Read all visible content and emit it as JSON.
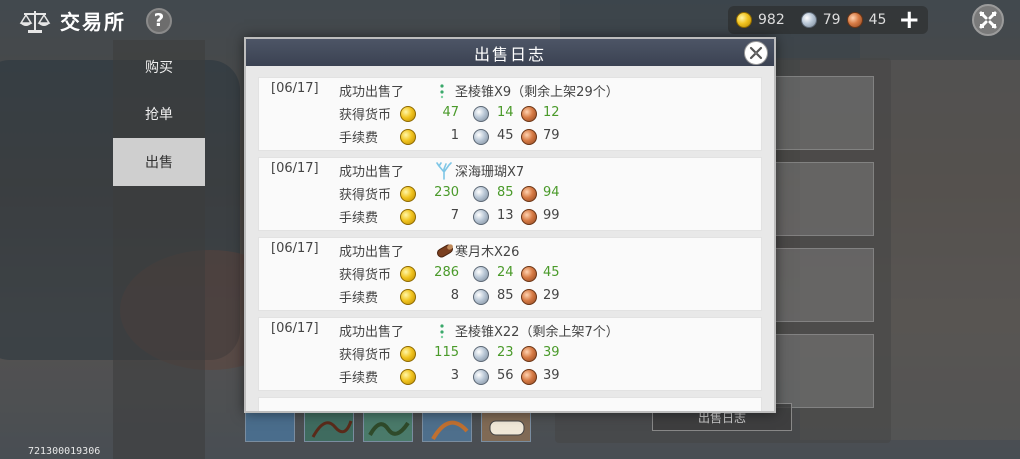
{
  "header": {
    "title": "交易所",
    "help_label": "?"
  },
  "currency": {
    "gold": "982",
    "silver": "79",
    "copper": "45",
    "add_label": "+"
  },
  "tabs": [
    {
      "label": "购买",
      "active": false
    },
    {
      "label": "抢单",
      "active": false
    },
    {
      "label": "出售",
      "active": true
    }
  ],
  "modal": {
    "title": "出售日志",
    "entries": [
      {
        "date": "[06/17]",
        "action": "成功出售了",
        "item": "圣棱锥X9（剩余上架29个）",
        "item_icon": "cone-icon",
        "income_label": "获得货币",
        "income": {
          "gold": "47",
          "silver": "14",
          "copper": "12"
        },
        "fee_label": "手续费",
        "fee": {
          "gold": "1",
          "silver": "45",
          "copper": "79"
        }
      },
      {
        "date": "[06/17]",
        "action": "成功出售了",
        "item": "深海珊瑚X7",
        "item_icon": "coral-icon",
        "income_label": "获得货币",
        "income": {
          "gold": "230",
          "silver": "85",
          "copper": "94"
        },
        "fee_label": "手续费",
        "fee": {
          "gold": "7",
          "silver": "13",
          "copper": "99"
        }
      },
      {
        "date": "[06/17]",
        "action": "成功出售了",
        "item": "寒月木X26",
        "item_icon": "wood-log-icon",
        "income_label": "获得货币",
        "income": {
          "gold": "286",
          "silver": "24",
          "copper": "45"
        },
        "fee_label": "手续费",
        "fee": {
          "gold": "8",
          "silver": "85",
          "copper": "29"
        }
      },
      {
        "date": "[06/17]",
        "action": "成功出售了",
        "item": "圣棱锥X22（剩余上架7个）",
        "item_icon": "cone-icon",
        "income_label": "获得货币",
        "income": {
          "gold": "115",
          "silver": "23",
          "copper": "39"
        },
        "fee_label": "手续费",
        "fee": {
          "gold": "3",
          "silver": "56",
          "copper": "39"
        }
      }
    ]
  },
  "right_panel": {
    "log_button_label": "出售日志"
  },
  "footer": {
    "id": "721300019306"
  },
  "colors": {
    "income_value": "#4a9a2a",
    "modal_header": "#434b5b"
  }
}
